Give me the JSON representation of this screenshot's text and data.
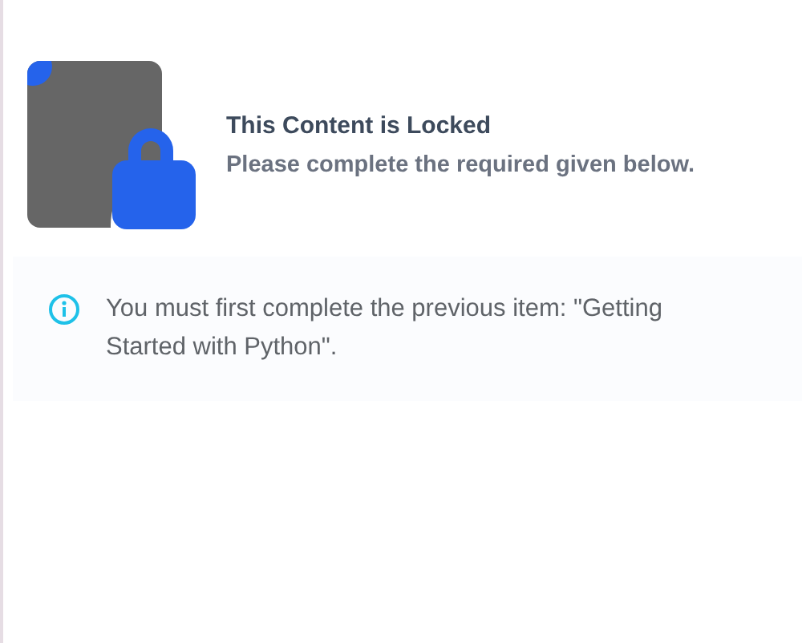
{
  "locked": {
    "title": "This Content is Locked",
    "subtitle": "Please complete the required given below."
  },
  "notice": {
    "kind": "info",
    "message": "You must first complete the previous item: \"Getting Started with Python\"."
  }
}
